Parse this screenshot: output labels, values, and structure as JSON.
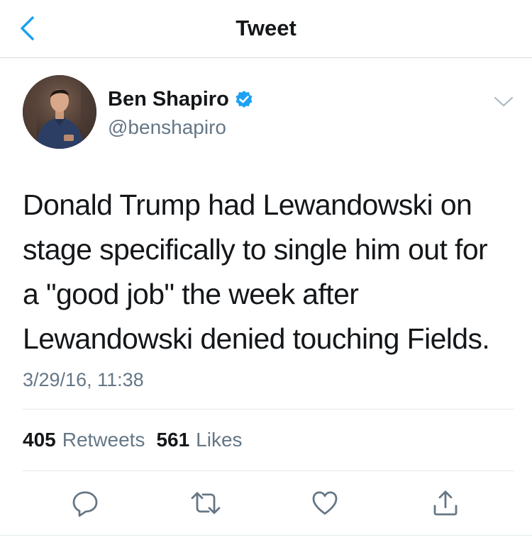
{
  "nav": {
    "title": "Tweet",
    "back_icon": "chevron-left-icon"
  },
  "tweet": {
    "author_name": "Ben Shapiro",
    "author_handle": "@benshapiro",
    "verified": true,
    "text_lines": [
      "Donald Trump had Lewandowski on",
      "stage specifically to single him out for",
      "a \"good job\" the week after",
      "Lewandowski denied touching Fields."
    ],
    "timestamp": "3/29/16, 11:38",
    "retweets_count": "405",
    "retweets_label": "Retweets",
    "likes_count": "561",
    "likes_label": "Likes"
  },
  "actions": [
    {
      "icon": "reply-icon"
    },
    {
      "icon": "retweet-icon"
    },
    {
      "icon": "like-heart-icon"
    },
    {
      "icon": "share-icon"
    }
  ],
  "colors": {
    "accent": "#1da1f2",
    "text": "#14171a",
    "secondary_text": "#657786",
    "divider": "#e1e8ed"
  }
}
